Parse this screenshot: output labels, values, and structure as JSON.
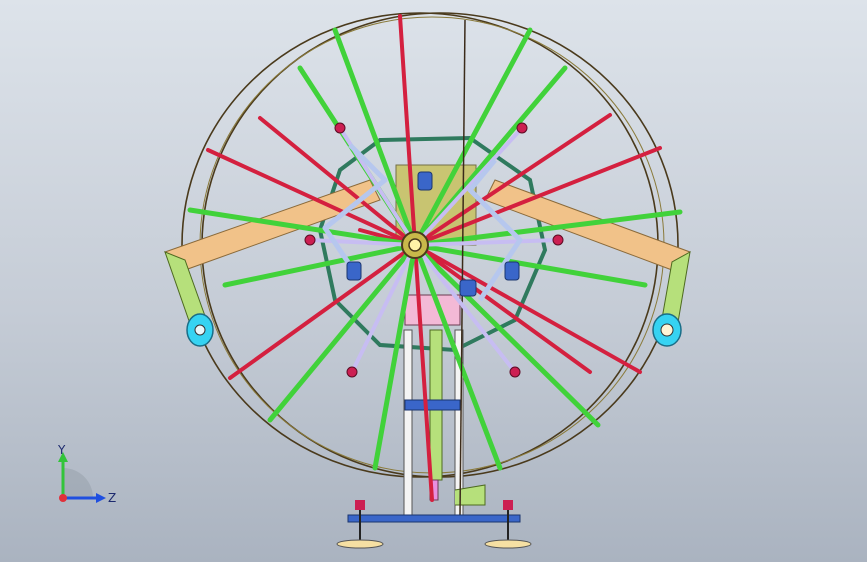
{
  "view": {
    "background_top": "#dde3ea",
    "background_bottom": "#aab3c0"
  },
  "model": {
    "spoke_colors": {
      "red": "#d4203f",
      "green": "#41d23a",
      "lavender": "#c7bdf2",
      "light_blue": "#b6c7ee",
      "dark_green": "#2f7a5e"
    },
    "rim_color": "#4a3a1c",
    "beam_color": "#f1c289",
    "leg_color": "#b6e07b",
    "wheel_color": "#36d3f2",
    "knob_color": "#cc1f52",
    "base_plate_color": "#3a66c9",
    "foot_color": "#f6e0a3"
  },
  "triad": {
    "y_label": "Y",
    "z_label": "Z",
    "y_color": "#32c43a",
    "z_color": "#1f4fe0",
    "origin_color": "#e0303a"
  }
}
